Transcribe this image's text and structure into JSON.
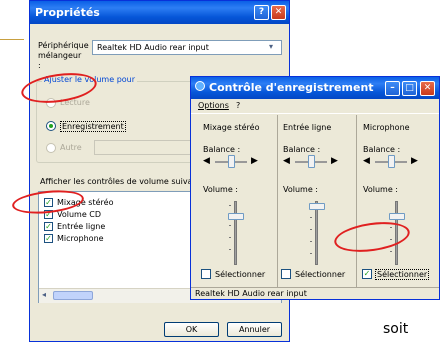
{
  "prop": {
    "title": "Propriétés",
    "help_btn": "?",
    "close_btn": "✕",
    "mixer_label": "Périphérique mélangeur :",
    "mixer_value": "Realtek HD Audio rear input",
    "adjust_label": "Ajuster le volume pour",
    "radio_lecture": "Lecture",
    "radio_enregistrement": "Enregistrement",
    "radio_autre": "Autre",
    "show_label": "Afficher les contrôles de volume suivants :",
    "items": [
      {
        "label": "Mixage stéréo",
        "checked": true
      },
      {
        "label": "Volume CD",
        "checked": true
      },
      {
        "label": "Entrée ligne",
        "checked": true
      },
      {
        "label": "Microphone",
        "checked": true
      }
    ],
    "ok": "OK",
    "cancel": "Annuler"
  },
  "ctrl": {
    "title": "Contrôle d'enregistrement",
    "menu_options": "Options",
    "menu_help": "?",
    "columns": [
      {
        "name": "Mixage stéréo",
        "balance": "Balance :",
        "volume": "Volume :",
        "select": "Sélectionner",
        "selected": false
      },
      {
        "name": "Entrée ligne",
        "balance": "Balance :",
        "volume": "Volume :",
        "select": "Sélectionner",
        "selected": false
      },
      {
        "name": "Microphone",
        "balance": "Balance :",
        "volume": "Volume :",
        "select": "Sélectionner",
        "selected": true
      }
    ],
    "status": "Realtek HD Audio rear input"
  },
  "caption": "soit",
  "colors": {
    "annotation": "#e02020",
    "titlebar": "#0a5fe6",
    "face": "#ece9d8"
  }
}
